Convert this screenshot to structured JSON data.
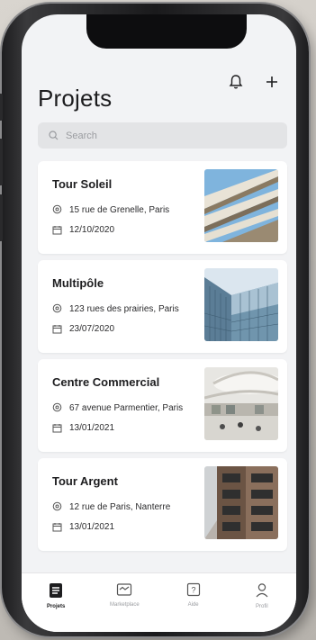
{
  "header": {
    "title": "Projets"
  },
  "search": {
    "placeholder": "Search"
  },
  "projects": [
    {
      "name": "Tour Soleil",
      "address": "15 rue de Grenelle, Paris",
      "date": "12/10/2020",
      "image": "building-facade-image"
    },
    {
      "name": "Multipôle",
      "address": "123 rues des prairies, Paris",
      "date": "23/07/2020",
      "image": "glass-tower-image"
    },
    {
      "name": "Centre Commercial",
      "address": "67 avenue Parmentier, Paris",
      "date": "13/01/2021",
      "image": "mall-interior-image"
    },
    {
      "name": "Tour Argent",
      "address": "12 rue de Paris, Nanterre",
      "date": "13/01/2021",
      "image": "modern-building-image"
    }
  ],
  "tabbar": {
    "items": [
      {
        "label": "Projets",
        "icon": "document-icon",
        "active": true
      },
      {
        "label": "Marketplace",
        "icon": "store-icon",
        "active": false
      },
      {
        "label": "Aide",
        "icon": "help-icon",
        "active": false
      },
      {
        "label": "Profil",
        "icon": "user-icon",
        "active": false
      }
    ]
  },
  "colors": {
    "background": "#f2f3f5",
    "card": "#ffffff",
    "text": "#1d1d1f",
    "muted": "#9a9ca0"
  }
}
